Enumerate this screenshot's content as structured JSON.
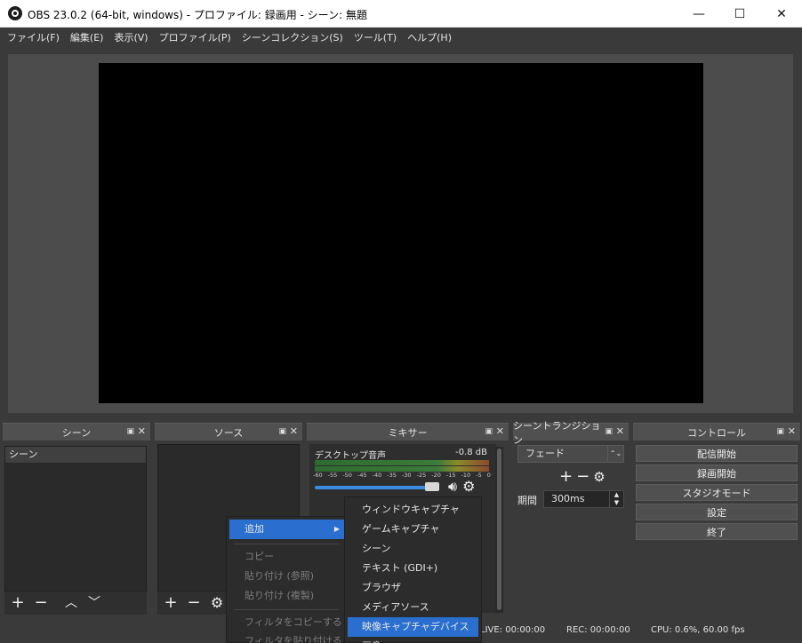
{
  "window": {
    "title": "OBS 23.0.2 (64-bit, windows) - プロファイル: 録画用 - シーン: 無題",
    "minimize": "—",
    "maximize": "☐",
    "close": "✕"
  },
  "menu": [
    "ファイル(F)",
    "編集(E)",
    "表示(V)",
    "プロファイル(P)",
    "シーンコレクション(S)",
    "ツール(T)",
    "ヘルプ(H)"
  ],
  "docks": {
    "scenes": {
      "title": "シーン",
      "items": [
        "シーン"
      ]
    },
    "sources": {
      "title": "ソース"
    },
    "mixer": {
      "title": "ミキサー",
      "track": "デスクトップ音声",
      "level": "-0.8 dB",
      "scale": [
        "-60",
        "-55",
        "-50",
        "-45",
        "-40",
        "-35",
        "-30",
        "-25",
        "-20",
        "-15",
        "-10",
        "-5",
        "0"
      ]
    },
    "transitions": {
      "title": "シーントランジション",
      "selected": "フェード",
      "duration_label": "期間",
      "duration": "300ms"
    },
    "controls": {
      "title": "コントロール",
      "buttons": [
        "配信開始",
        "録画開始",
        "スタジオモード",
        "設定",
        "終了"
      ]
    }
  },
  "dock_icons": {
    "float": "▣",
    "close": "✕"
  },
  "status": {
    "live": "LIVE: 00:00:00",
    "rec": "REC: 00:00:00",
    "cpu": "CPU: 0.6%, 60.00 fps"
  },
  "context_menu": {
    "items": [
      {
        "label": "追加",
        "state": "active",
        "submenu": true
      },
      {
        "label": "コピー",
        "state": "disabled"
      },
      {
        "label": "貼り付け (参照)",
        "state": "disabled"
      },
      {
        "label": "貼り付け (複製)",
        "state": "disabled"
      },
      {
        "label": "フィルタをコピーする",
        "state": "disabled"
      },
      {
        "label": "フィルタを貼り付ける",
        "state": "disabled"
      }
    ]
  },
  "submenu": {
    "items": [
      {
        "label": "ウィンドウキャプチャ",
        "state": "normal"
      },
      {
        "label": "ゲームキャプチャ",
        "state": "normal"
      },
      {
        "label": "シーン",
        "state": "normal"
      },
      {
        "label": "テキスト (GDI+)",
        "state": "normal"
      },
      {
        "label": "ブラウザ",
        "state": "normal"
      },
      {
        "label": "メディアソース",
        "state": "normal"
      },
      {
        "label": "映像キャプチャデバイス",
        "state": "active"
      },
      {
        "label": "画像",
        "state": "normal"
      }
    ]
  }
}
